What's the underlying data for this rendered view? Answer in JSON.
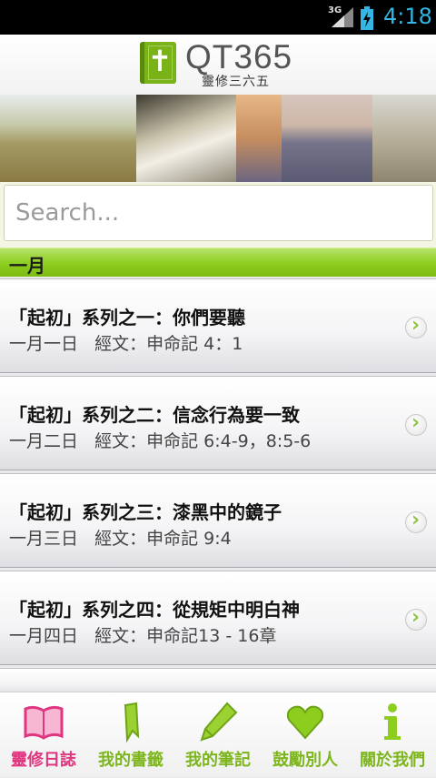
{
  "status": {
    "network": "3G",
    "time": "4:18"
  },
  "header": {
    "title": "QT365",
    "subtitle": "靈修三六五"
  },
  "search": {
    "placeholder": "Search..."
  },
  "month": {
    "label": "一月"
  },
  "items": [
    {
      "title": "「起初」系列之一：你們要聽",
      "date": "一月一日",
      "scripture": "經文：申命記 4：1"
    },
    {
      "title": "「起初」系列之二：信念行為要一致",
      "date": "一月二日",
      "scripture": "經文：申命記 6:4-9，8:5-6"
    },
    {
      "title": "「起初」系列之三：漆黑中的鏡子",
      "date": "一月三日",
      "scripture": "經文：申命記 9:4"
    },
    {
      "title": "「起初」系列之四：從規矩中明白神",
      "date": "一月四日",
      "scripture": "經文：申命記13 - 16章"
    }
  ],
  "tabs": [
    {
      "label": "靈修日誌",
      "icon": "book-icon",
      "active": true
    },
    {
      "label": "我的書籤",
      "icon": "bookmark-icon",
      "active": false
    },
    {
      "label": "我的筆記",
      "icon": "pencil-icon",
      "active": false
    },
    {
      "label": "鼓勵別人",
      "icon": "heart-icon",
      "active": false
    },
    {
      "label": "關於我們",
      "icon": "info-icon",
      "active": false
    }
  ],
  "colors": {
    "accent_green": "#8ccd1e",
    "active_tab": "#e0357f",
    "status_blue": "#33b5e5"
  }
}
